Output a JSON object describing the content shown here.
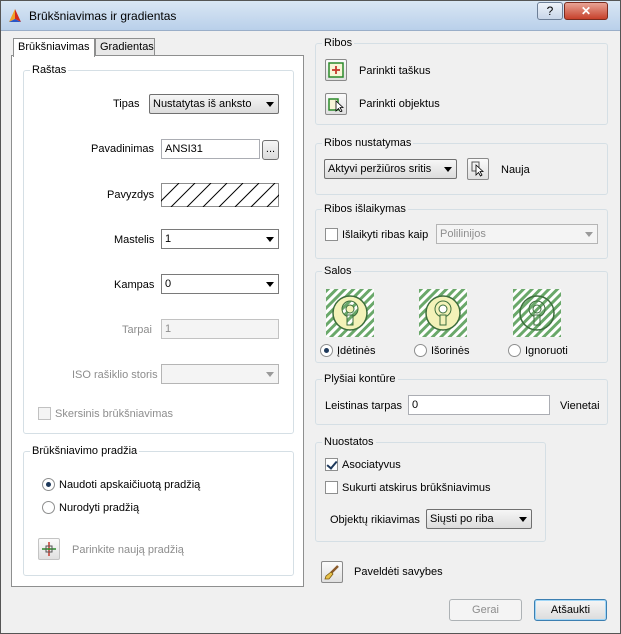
{
  "window": {
    "title": "Brūkšniavimas ir gradientas",
    "help_label": "?",
    "close_label": "✕"
  },
  "tabs": [
    {
      "label": "Brūkšniavimas"
    },
    {
      "label": "Gradientas"
    }
  ],
  "rastas": {
    "legend": "Raštas",
    "tipas": {
      "label": "Tipas",
      "value": "Nustatytas iš anksto"
    },
    "pavadinimas": {
      "label": "Pavadinimas",
      "value": "ANSI31",
      "browse_label": "..."
    },
    "pavyzdys": {
      "label": "Pavyzdys"
    },
    "mastelis": {
      "label": "Mastelis",
      "value": "1"
    },
    "kampas": {
      "label": "Kampas",
      "value": "0"
    },
    "tarpai": {
      "label": "Tarpai",
      "value": "1"
    },
    "iso": {
      "label": "ISO rašiklio storis",
      "value": ""
    },
    "skersinis": {
      "label": "Skersinis brūkšniavimas"
    }
  },
  "pradzia": {
    "legend": "Brūkšniavimo pradžia",
    "opt_auto": "Naudoti apskaičiuotą pradžią",
    "opt_specify": "Nurodyti pradžią",
    "pick_label": "Parinkite naują pradžią"
  },
  "ribos": {
    "legend": "Ribos",
    "pick_points": "Parinkti taškus",
    "pick_objects": "Parinkti objektus"
  },
  "ribos_nustatymas": {
    "legend": "Ribos nustatymas",
    "value": "Aktyvi peržiūros sritis",
    "new_label": "Nauja"
  },
  "ribos_islaikymas": {
    "legend": "Ribos išlaikymas",
    "keep_label": "Išlaikyti ribas kaip",
    "type_value": "Polilinijos"
  },
  "salos": {
    "legend": "Salos",
    "opt_inner": "Įdėtinės",
    "opt_outer": "Išorinės",
    "opt_ignore": "Ignoruoti"
  },
  "plysiai": {
    "legend": "Plyšiai kontūre",
    "gap_label": "Leistinas tarpas",
    "gap_value": "0",
    "units_label": "Vienetai"
  },
  "nuostatos": {
    "legend": "Nuostatos",
    "assoc_label": "Asociatyvus",
    "separate_label": "Sukurti atskirus brūkšniavimus",
    "order_label": "Objektų rikiavimas",
    "order_value": "Siųsti po riba"
  },
  "inherit_label": "Paveldėti savybes",
  "buttons": {
    "ok": "Gerai",
    "cancel": "Atšaukti"
  },
  "colors": {
    "accent_green": "#2b8a2b",
    "island_fill": "#f3f2b8",
    "hatch_green": "#6aa86a"
  }
}
